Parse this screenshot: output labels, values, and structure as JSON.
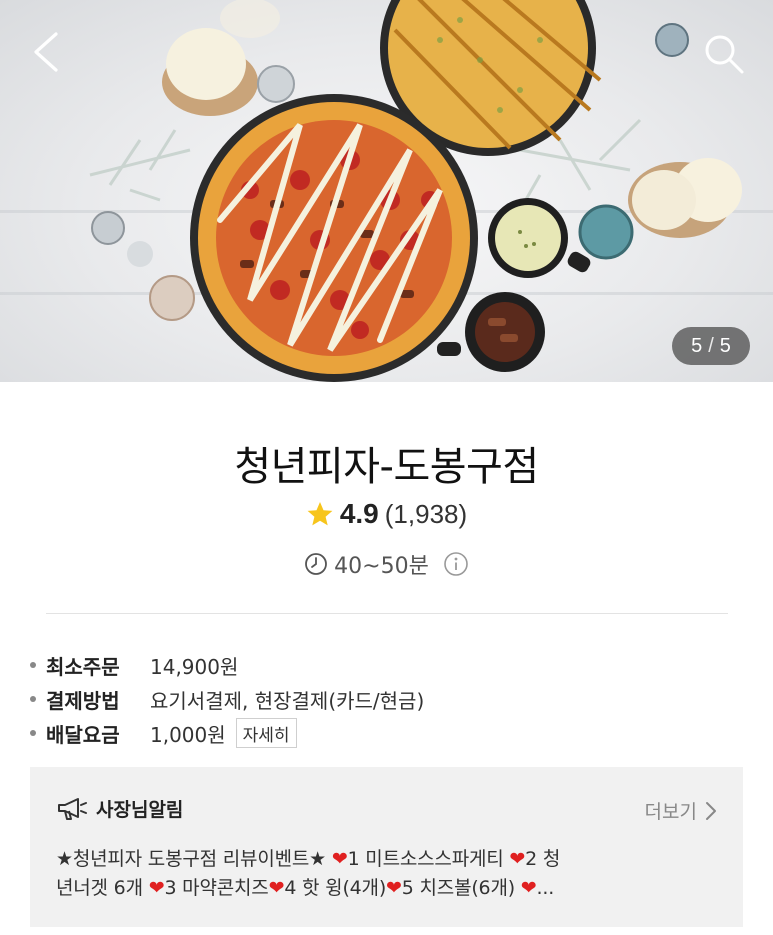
{
  "header": {
    "back_icon": "chevron-left-icon",
    "search_icon": "search-icon",
    "page_indicator": {
      "current": "5",
      "separator": "/",
      "total": "5"
    }
  },
  "store": {
    "name": "청년피자-도봉구점",
    "rating": "4.9",
    "review_count": "(1,938)",
    "delivery_time": "40~50분",
    "star_color": "#f7c51c"
  },
  "info": {
    "min_order_label": "최소주문",
    "min_order_value": "14,900원",
    "payment_label": "결제방법",
    "payment_value": "요기서결제, 현장결제(카드/현금)",
    "delivery_fee_label": "배달요금",
    "delivery_fee_value": "1,000원",
    "detail_button": "자세히"
  },
  "notice": {
    "title": "사장님알림",
    "more_label": "더보기",
    "line1_prefix": "★청년피자 도봉구점 리뷰이벤트★ ",
    "heart": "❤",
    "line1_item1": "1 미트소스스파게티 ",
    "line1_item2": "2 청",
    "line2_text1": "년너겟 6개 ",
    "line2_item3": "3 마약콘치즈",
    "line2_item4": "4 핫 윙(4개)",
    "line2_item5": "5 치즈볼(6개)",
    "ellipsis": "..."
  }
}
